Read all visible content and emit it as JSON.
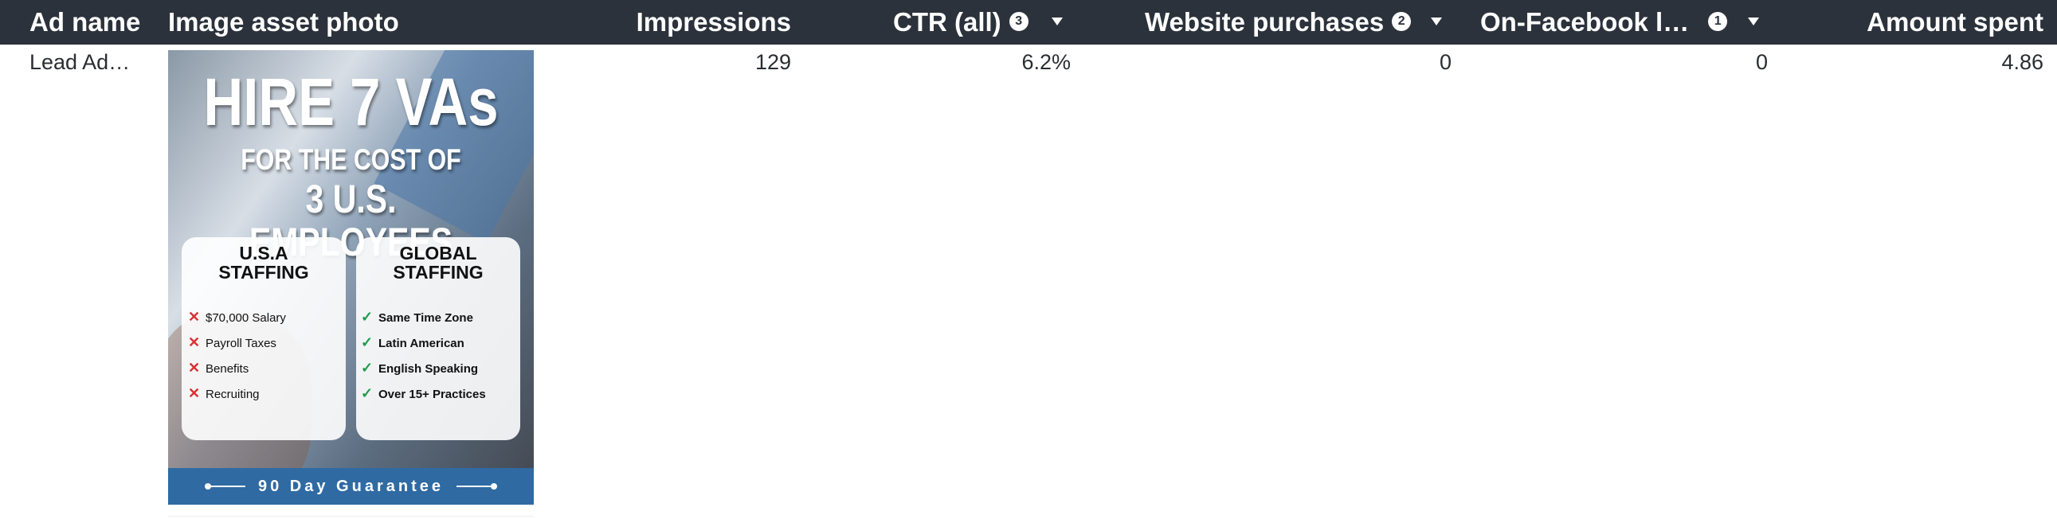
{
  "columns": {
    "ad_name": "Ad name",
    "image_asset_photo": "Image asset photo",
    "impressions": "Impressions",
    "ctr_all": {
      "label": "CTR (all)",
      "badge": "3"
    },
    "website_purchases": {
      "label": "Website purchases",
      "badge": "2"
    },
    "on_facebook": {
      "label": "On-Facebook l…",
      "badge": "1"
    },
    "amount_spent": "Amount spent"
  },
  "row": {
    "ad_name": "Lead Ad…",
    "impressions": "129",
    "ctr_all": "6.2%",
    "website_purchases": "0",
    "on_facebook": "0",
    "amount_spent": "4.86"
  },
  "creative": {
    "headline": "HIRE 7 VAs",
    "sub1": "FOR THE COST OF",
    "sub2": "3 U.S. EMPLOYEES",
    "left_card": {
      "title1": "U.S.A",
      "title2": "STAFFING",
      "items": [
        "$70,000 Salary",
        "Payroll Taxes",
        "Benefits",
        "Recruiting"
      ]
    },
    "right_card": {
      "title1": "GLOBAL",
      "title2": "STAFFING",
      "items": [
        "Same Time Zone",
        "Latin American",
        "English Speaking",
        "Over 15+ Practices"
      ]
    },
    "footer": "90 Day Guarantee"
  },
  "colors": {
    "header_bg": "#2b323b",
    "footer_bar": "#2f6aa3",
    "cross": "#d93030",
    "check": "#1e9a4a"
  }
}
